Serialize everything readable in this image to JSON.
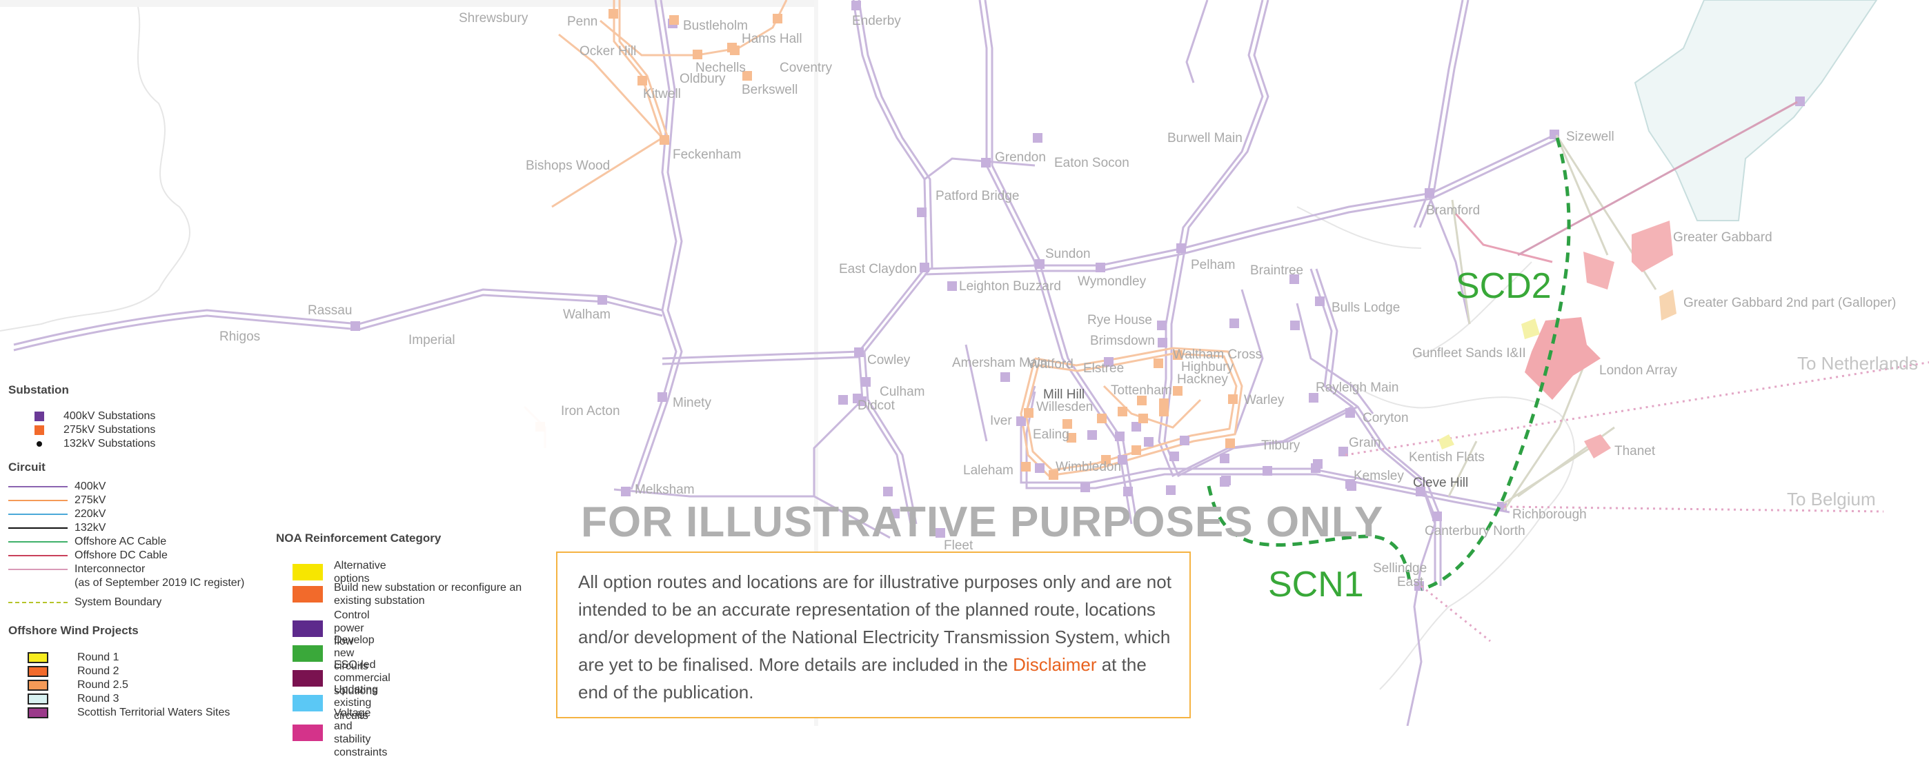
{
  "watermark": "FOR ILLUSTRATIVE PURPOSES ONLY",
  "callouts": {
    "scd2": "SCD2",
    "scn1": "SCN1"
  },
  "sea_labels": {
    "netherlands": "To Netherlands",
    "belgium": "To Belgium"
  },
  "place_labels": [
    {
      "id": "shrewsbury",
      "text": "Shrewsbury"
    },
    {
      "id": "penn",
      "text": "Penn"
    },
    {
      "id": "bustleholm",
      "text": "Bustleholm"
    },
    {
      "id": "hams-hall",
      "text": "Hams Hall"
    },
    {
      "id": "ocker-hill",
      "text": "Ocker Hill"
    },
    {
      "id": "nechells",
      "text": "Nechells"
    },
    {
      "id": "oldbury",
      "text": "Oldbury"
    },
    {
      "id": "coventry",
      "text": "Coventry"
    },
    {
      "id": "kitwell",
      "text": "Kitwell"
    },
    {
      "id": "berkswell",
      "text": "Berkswell"
    },
    {
      "id": "enderby",
      "text": "Enderby"
    },
    {
      "id": "bishops-wood",
      "text": "Bishops Wood"
    },
    {
      "id": "feckenham",
      "text": "Feckenham"
    },
    {
      "id": "burwell-main",
      "text": "Burwell Main"
    },
    {
      "id": "sizewell",
      "text": "Sizewell"
    },
    {
      "id": "grendon",
      "text": "Grendon"
    },
    {
      "id": "eaton-socon",
      "text": "Eaton Socon"
    },
    {
      "id": "patford-bridge",
      "text": "Patford Bridge"
    },
    {
      "id": "bramford",
      "text": "Bramford"
    },
    {
      "id": "greater-gabbard",
      "text": "Greater Gabbard"
    },
    {
      "id": "sundon",
      "text": "Sundon"
    },
    {
      "id": "east-claydon",
      "text": "East Claydon"
    },
    {
      "id": "wymondley",
      "text": "Wymondley"
    },
    {
      "id": "pelham",
      "text": "Pelham"
    },
    {
      "id": "braintree",
      "text": "Braintree"
    },
    {
      "id": "leighton-buzzard",
      "text": "Leighton Buzzard"
    },
    {
      "id": "greater-gabbard-2",
      "text": "Greater Gabbard 2nd part (Galloper)"
    },
    {
      "id": "rassau",
      "text": "Rassau"
    },
    {
      "id": "walham",
      "text": "Walham"
    },
    {
      "id": "bulls-lodge",
      "text": "Bulls Lodge"
    },
    {
      "id": "rhigos",
      "text": "Rhigos"
    },
    {
      "id": "imperial",
      "text": "Imperial"
    },
    {
      "id": "rye-house",
      "text": "Rye House"
    },
    {
      "id": "brimsdown",
      "text": "Brimsdown"
    },
    {
      "id": "gunfleet-sands",
      "text": "Gunfleet Sands I&II"
    },
    {
      "id": "waltham-cross",
      "text": "Waltham Cross"
    },
    {
      "id": "cowley",
      "text": "Cowley"
    },
    {
      "id": "amersham-main",
      "text": "Amersham Main"
    },
    {
      "id": "watford",
      "text": "Watford"
    },
    {
      "id": "elstree",
      "text": "Elstree"
    },
    {
      "id": "highbury",
      "text": "Highbury"
    },
    {
      "id": "hackney",
      "text": "Hackney"
    },
    {
      "id": "london-array",
      "text": "London Array"
    },
    {
      "id": "iron-acton",
      "text": "Iron Acton"
    },
    {
      "id": "minety",
      "text": "Minety"
    },
    {
      "id": "culham",
      "text": "Culham"
    },
    {
      "id": "didcot",
      "text": "Didcot"
    },
    {
      "id": "mill-hill",
      "text": "Mill Hill"
    },
    {
      "id": "tottenham",
      "text": "Tottenham"
    },
    {
      "id": "warley",
      "text": "Warley"
    },
    {
      "id": "rayleigh-main",
      "text": "Rayleigh Main"
    },
    {
      "id": "willesden",
      "text": "Willesden"
    },
    {
      "id": "iver",
      "text": "Iver"
    },
    {
      "id": "ealing",
      "text": "Ealing"
    },
    {
      "id": "coryton",
      "text": "Coryton"
    },
    {
      "id": "grain",
      "text": "Grain"
    },
    {
      "id": "tilbury",
      "text": "Tilbury"
    },
    {
      "id": "kentish-flats",
      "text": "Kentish Flats"
    },
    {
      "id": "thanet",
      "text": "Thanet"
    },
    {
      "id": "laleham",
      "text": "Laleham"
    },
    {
      "id": "wimbledon",
      "text": "Wimbledon"
    },
    {
      "id": "melksham",
      "text": "Melksham"
    },
    {
      "id": "kemsley",
      "text": "Kemsley"
    },
    {
      "id": "cleve-hill",
      "text": "Cleve Hill"
    },
    {
      "id": "fleet",
      "text": "Fleet"
    },
    {
      "id": "canterbury-north",
      "text": "Canterbury North"
    },
    {
      "id": "richborough",
      "text": "Richborough"
    },
    {
      "id": "sellindge",
      "text": "Sellindge"
    },
    {
      "id": "sellindge-east",
      "text": "East"
    }
  ],
  "legend": {
    "substation": {
      "title": "Substation",
      "items": [
        {
          "label": "400kV Substations",
          "color": "#6b3a97"
        },
        {
          "label": "275kV Substations",
          "color": "#f26a2b"
        },
        {
          "label": "132kV Substations",
          "color": "#111111"
        }
      ]
    },
    "circuit": {
      "title": "Circuit",
      "items": [
        {
          "label": "400kV",
          "color": "#8a63b0"
        },
        {
          "label": "275kV",
          "color": "#f59a57"
        },
        {
          "label": "220kV",
          "color": "#4aa8d8"
        },
        {
          "label": "132kV",
          "color": "#111111"
        },
        {
          "label": "Offshore AC Cable",
          "color": "#3fb06a"
        },
        {
          "label": "Offshore DC Cable",
          "color": "#c9405a"
        },
        {
          "label": "Interconnector",
          "color": "#d99ab8"
        },
        {
          "label": "(as of September 2019 IC register)",
          "color": ""
        },
        {
          "label": "System Boundary",
          "color": "#b5c42a"
        }
      ]
    },
    "wind": {
      "title": "Offshore Wind Projects",
      "items": [
        {
          "label": "Round 1",
          "color": "#f7ec1f"
        },
        {
          "label": "Round 2",
          "color": "#f26a2b"
        },
        {
          "label": "Round 2.5",
          "color": "#f59a57"
        },
        {
          "label": "Round 3",
          "color": "#d8f2f2"
        },
        {
          "label": "Scottish Territorial Waters Sites",
          "color": "#9b3a8a"
        }
      ]
    }
  },
  "noa": {
    "title": "NOA Reinforcement Category",
    "items": [
      {
        "label": "Alternative options",
        "color": "#f7e600"
      },
      {
        "label": "Build new substation or reconfigure an existing substation",
        "color": "#f26a2b"
      },
      {
        "label": "Control power flow",
        "color": "#5d2a8c"
      },
      {
        "label": "Develop new circuits",
        "color": "#3aa83a"
      },
      {
        "label": "ESO-led commercial solutions",
        "color": "#7a1250"
      },
      {
        "label": "Updating existing circuits",
        "color": "#5bc8f5"
      },
      {
        "label": "Voltage and stability constraints",
        "color": "#d4338a"
      }
    ]
  },
  "disclaimer": {
    "text": "All option routes and locations are for illustrative purposes only and are not intended to be an accurate representation of the planned route, locations and/or development of the National Electricity Transmission System, which are yet to be finalised. More details are included in the",
    "link": "Disclaimer",
    "tail": " at the end of the publication."
  }
}
